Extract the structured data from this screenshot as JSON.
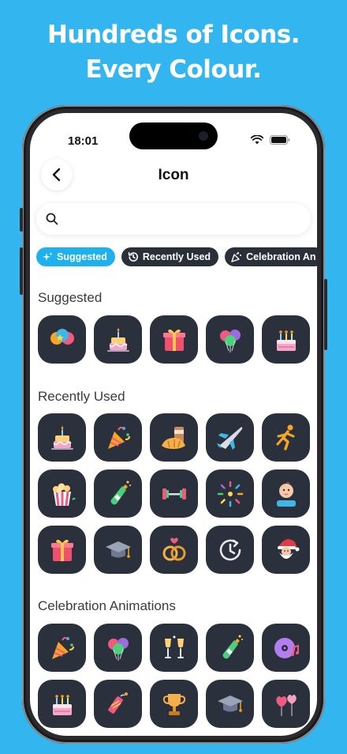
{
  "promo": {
    "line1": "Hundreds of Icons.",
    "line2": "Every Colour."
  },
  "status_bar": {
    "time": "18:01"
  },
  "nav": {
    "title": "Icon"
  },
  "search": {
    "placeholder": "",
    "value": ""
  },
  "chips": [
    {
      "label": "Suggested",
      "icon": "sparkles-icon",
      "active": true
    },
    {
      "label": "Recently Used",
      "icon": "history-icon",
      "active": false
    },
    {
      "label": "Celebration An",
      "icon": "party-popper-icon",
      "active": false
    }
  ],
  "sections": {
    "suggested": {
      "title": "Suggested",
      "icons": [
        "balloons-icon",
        "birthday-cake-icon",
        "gift-box-icon",
        "party-balloons-icon",
        "birthday-cake-candles-icon"
      ]
    },
    "recent": {
      "title": "Recently Used",
      "icons": [
        "birthday-cake-icon",
        "party-popper-icon",
        "croissant-coffee-icon",
        "airplane-icon",
        "runner-icon",
        "popcorn-icon",
        "champagne-bottle-icon",
        "dumbbell-icon",
        "fireworks-icon",
        "baby-icon",
        "gift-box-icon",
        "graduation-cap-icon",
        "wedding-rings-icon",
        "clock-icon",
        "santa-icon"
      ]
    },
    "celebration": {
      "title": "Celebration Animations",
      "icons": [
        "party-popper-icon",
        "party-balloons-icon",
        "champagne-glasses-icon",
        "champagne-bottle-icon",
        "music-disc-icon",
        "birthday-cake-candles-icon",
        "firecracker-icon",
        "trophy-icon",
        "graduation-cap-icon",
        "heart-balloons-icon"
      ]
    }
  },
  "colors": {
    "background": "#33b5f0",
    "accent": "#1fb0ee",
    "tile": "#2b303d",
    "chip": "#2b2f3a"
  }
}
